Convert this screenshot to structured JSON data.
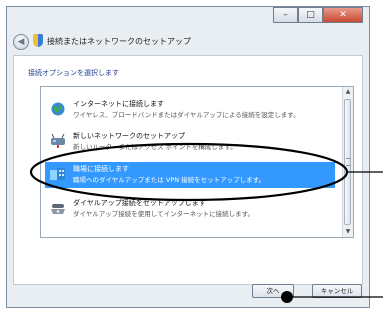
{
  "window": {
    "title": "接続またはネットワークのセットアップ",
    "controls": {
      "minimize": "–",
      "maximize": "□",
      "close": "✕"
    },
    "back_button": "◀"
  },
  "content": {
    "instruction": "接続オプションを選択します",
    "options": [
      {
        "icon": "internet-globe-icon",
        "title": "インターネットに接続します",
        "description": "ワイヤレス、ブロードバンドまたはダイヤルアップによる接続を設定します。"
      },
      {
        "icon": "network-setup-icon",
        "title": "新しいネットワークのセットアップ",
        "description": "新しいルーターまたはアクセス ポイントを構成します。"
      },
      {
        "icon": "workplace-connection-icon",
        "title": "職場に接続します",
        "description": "職場へのダイヤルアップまたは VPN 接続をセットアップします。",
        "selected": true
      },
      {
        "icon": "dialup-phone-icon",
        "title": "ダイヤルアップ接続をセットアップします",
        "description": "ダイヤルアップ接続を使用してインターネットに接続します。"
      }
    ],
    "scrollbar": {
      "up": "▲",
      "down": "▼"
    }
  },
  "buttons": {
    "next": "次へ",
    "cancel": "キャンセル"
  }
}
